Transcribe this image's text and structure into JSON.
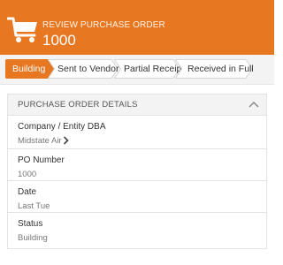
{
  "header": {
    "subtitle": "REVIEW PURCHASE ORDER",
    "title": "1000",
    "icon": "shopping-cart-icon",
    "background": "#e87722"
  },
  "steps": [
    {
      "label": "Building",
      "active": true
    },
    {
      "label": "Sent to Vendor",
      "active": false
    },
    {
      "label": "Partial Receipt",
      "active": false
    },
    {
      "label": "Received in Full",
      "active": false
    }
  ],
  "colors": {
    "accent": "#e87722",
    "inactive_step": "#ffffff",
    "step_border": "#d6d6d6"
  },
  "details": {
    "title": "PURCHASE ORDER DETAILS",
    "collapse_icon": "chevron-up-icon",
    "fields": [
      {
        "label": "Company / Entity DBA",
        "value": "Midstate Air",
        "link": true
      },
      {
        "label": "PO Number",
        "value": "1000"
      },
      {
        "label": "Date",
        "value": "Last Tue"
      },
      {
        "label": "Status",
        "value": "Building"
      }
    ]
  }
}
